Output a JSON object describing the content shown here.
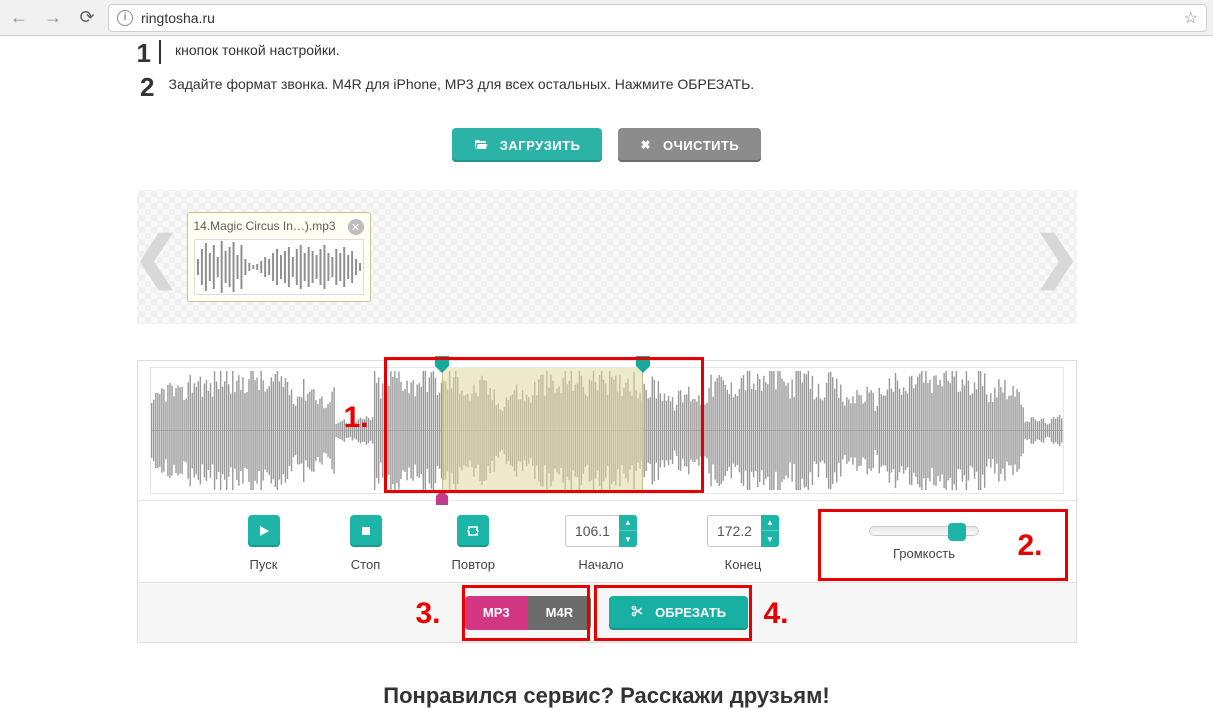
{
  "browser": {
    "url": "ringtosha.ru"
  },
  "steps": {
    "s1": {
      "num": "1",
      "text": "кнопок тонкой настройки."
    },
    "s2": {
      "num": "2",
      "text": "Задайте формат звонка. M4R для iPhone, MP3 для всех остальных. Нажмите ОБРЕЗАТЬ."
    }
  },
  "buttons": {
    "upload": "ЗАГРУЗИТЬ",
    "clear": "ОЧИСТИТЬ",
    "cut": "ОБРЕЗАТЬ"
  },
  "file": {
    "name": "14.Magic Circus In…).mp3"
  },
  "controls": {
    "play": "Пуск",
    "stop": "Стоп",
    "repeat": "Повтор",
    "start": "Начало",
    "end": "Конец",
    "volume": "Громкость",
    "start_val": "106.1",
    "end_val": "172.2"
  },
  "format": {
    "mp3": "MP3",
    "m4r": "M4R"
  },
  "annotations": {
    "a1": "1.",
    "a2": "2.",
    "a3": "3.",
    "a4": "4."
  },
  "footer": "Понравился сервис? Расскажи друзьям!"
}
